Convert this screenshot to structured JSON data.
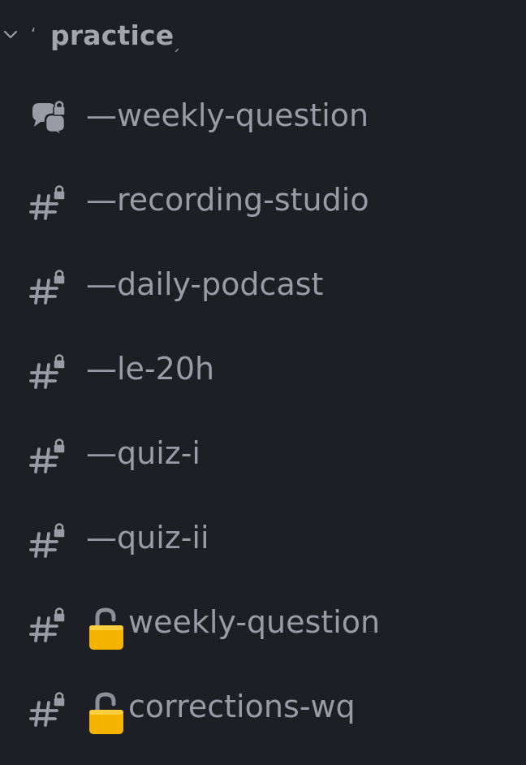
{
  "category": {
    "name": "practice",
    "mark_left": "ʻ",
    "mark_right": "ˏ"
  },
  "channels": [
    {
      "prefix": "—",
      "name": "weekly-question",
      "icon": "forum-locked-icon",
      "emoji": ""
    },
    {
      "prefix": "—",
      "name": "recording-studio",
      "icon": "text-channel-locked-icon",
      "emoji": ""
    },
    {
      "prefix": "—",
      "name": "daily-podcast",
      "icon": "text-channel-locked-icon",
      "emoji": ""
    },
    {
      "prefix": "—",
      "name": "le-20h",
      "icon": "text-channel-locked-icon",
      "emoji": ""
    },
    {
      "prefix": "—",
      "name": "quiz-i",
      "icon": "text-channel-locked-icon",
      "emoji": ""
    },
    {
      "prefix": "—",
      "name": "quiz-ii",
      "icon": "text-channel-locked-icon",
      "emoji": ""
    },
    {
      "prefix": "",
      "name": "weekly-question",
      "icon": "text-channel-locked-icon",
      "emoji": "open-padlock-emoji"
    },
    {
      "prefix": "",
      "name": "corrections-wq",
      "icon": "text-channel-locked-icon",
      "emoji": "open-padlock-emoji"
    }
  ],
  "colors": {
    "background": "#1e1f24",
    "text": "#9a9ca5",
    "lock_emoji": "#f5b400"
  }
}
